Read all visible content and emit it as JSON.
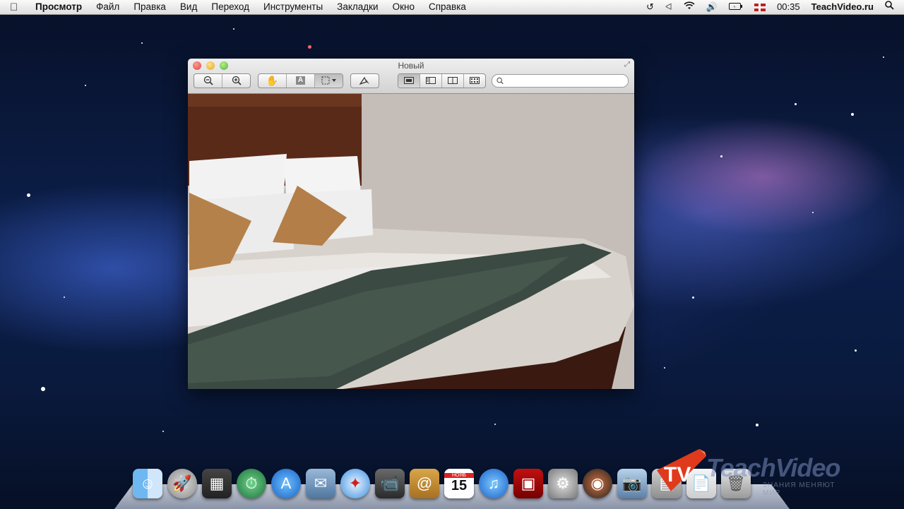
{
  "menubar": {
    "app_name": "Просмотр",
    "items": [
      "Файл",
      "Правка",
      "Вид",
      "Переход",
      "Инструменты",
      "Закладки",
      "Окно",
      "Справка"
    ],
    "clock": "00:35",
    "site": "TeachVideo.ru"
  },
  "window": {
    "title": "Новый",
    "search_placeholder": ""
  },
  "watermark": {
    "brand": "TeachVideo",
    "logo": "TV",
    "tagline": "ЗНАНИЯ МЕНЯЮТ МИР"
  },
  "dock": {
    "calendar_day": "15",
    "calendar_month": "НОЯБ"
  },
  "colors": {
    "menubar": "#e8e8e8",
    "canvas_bg": "#c5bdb8",
    "headboard": "#5a2a18",
    "throw": "#3b4a42",
    "pillow_accent": "#b5814a"
  }
}
